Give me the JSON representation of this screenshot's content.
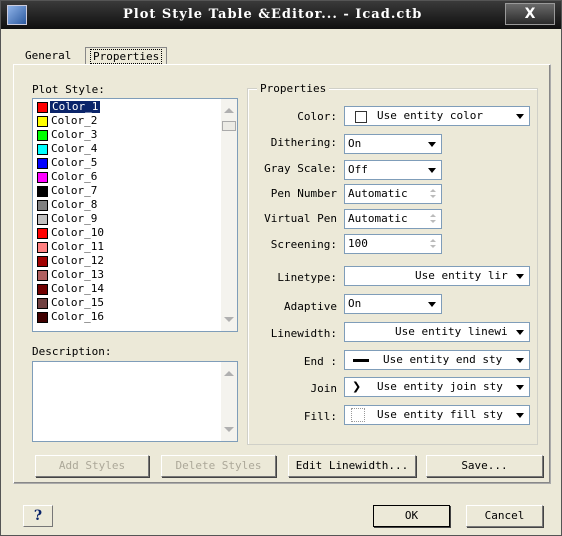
{
  "window": {
    "title": "Plot Style Table &Editor... - Icad.ctb",
    "close_label": "X"
  },
  "tabs": [
    {
      "label": "General"
    },
    {
      "label": "Properties"
    }
  ],
  "plot_style": {
    "label": "Plot Style:",
    "items": [
      {
        "label": "Color_1",
        "color": "#ff0000"
      },
      {
        "label": "Color_2",
        "color": "#ffff00"
      },
      {
        "label": "Color_3",
        "color": "#00ff00"
      },
      {
        "label": "Color_4",
        "color": "#00ffff"
      },
      {
        "label": "Color_5",
        "color": "#0000ff"
      },
      {
        "label": "Color_6",
        "color": "#ff00ff"
      },
      {
        "label": "Color_7",
        "color": "#000000"
      },
      {
        "label": "Color_8",
        "color": "#808080"
      },
      {
        "label": "Color_9",
        "color": "#c0c0c0"
      },
      {
        "label": "Color_10",
        "color": "#ff0000"
      },
      {
        "label": "Color_11",
        "color": "#ff8080"
      },
      {
        "label": "Color_12",
        "color": "#a00000"
      },
      {
        "label": "Color_13",
        "color": "#b06060"
      },
      {
        "label": "Color_14",
        "color": "#700000"
      },
      {
        "label": "Color_15",
        "color": "#704040"
      },
      {
        "label": "Color_16",
        "color": "#400000"
      }
    ],
    "selected_index": 0
  },
  "description": {
    "label": "Description:",
    "value": ""
  },
  "properties": {
    "group_label": "Properties",
    "color": {
      "label": "Color:",
      "value": "Use entity color"
    },
    "dithering": {
      "label": "Dithering:",
      "value": "On"
    },
    "gray_scale": {
      "label": "Gray Scale:",
      "value": "Off"
    },
    "pen_number": {
      "label": "Pen Number",
      "value": "Automatic"
    },
    "virtual_pen": {
      "label": "Virtual Pen",
      "value": "Automatic"
    },
    "screening": {
      "label": "Screening:",
      "value": "100"
    },
    "linetype": {
      "label": "Linetype:",
      "value": "Use entity lir"
    },
    "adaptive": {
      "label": "Adaptive",
      "value": "On"
    },
    "lineweight": {
      "label": "Linewidth:",
      "value": "Use entity linewi"
    },
    "end": {
      "label": "End :",
      "value": "Use entity end sty"
    },
    "join": {
      "label": "Join",
      "value": "Use entity join sty"
    },
    "fill": {
      "label": "Fill:",
      "value": "Use entity fill sty"
    }
  },
  "buttons": {
    "add_styles": "Add Styles",
    "delete_styles": "Delete Styles",
    "edit_linewidth": "Edit Linewidth...",
    "save": "Save...",
    "help": "?",
    "ok": "OK",
    "cancel": "Cancel"
  }
}
